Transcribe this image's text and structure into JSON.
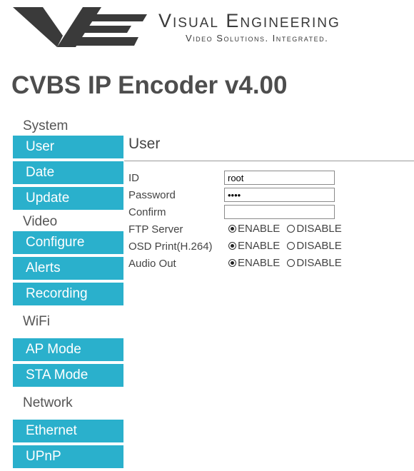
{
  "header": {
    "brand_title": "Visual Engineering",
    "brand_subtitle": "Video Solutions. Integrated.",
    "logo_icon": "visual-engineering-logo-icon"
  },
  "page_title": "CVBS IP Encoder v4.00",
  "nav": {
    "sections": [
      {
        "label": "System",
        "items": [
          "User",
          "Date",
          "Update"
        ]
      },
      {
        "label": "Video",
        "items": [
          "Configure",
          "Alerts",
          "Recording"
        ]
      },
      {
        "label": "WiFi",
        "items": [
          "AP Mode",
          "STA Mode"
        ]
      },
      {
        "label": "Network",
        "items": [
          "Ethernet",
          "UPnP"
        ]
      }
    ],
    "accent_color": "#2ab0cc"
  },
  "content": {
    "title": "User",
    "fields": {
      "id": {
        "label": "ID",
        "value": "root"
      },
      "password": {
        "label": "Password",
        "value": "••••"
      },
      "confirm": {
        "label": "Confirm",
        "value": ""
      }
    },
    "radios": [
      {
        "label": "FTP Server",
        "options": [
          "ENABLE",
          "DISABLE"
        ],
        "selected": "ENABLE"
      },
      {
        "label": "OSD Print(H.264)",
        "options": [
          "ENABLE",
          "DISABLE"
        ],
        "selected": "ENABLE"
      },
      {
        "label": "Audio Out",
        "options": [
          "ENABLE",
          "DISABLE"
        ],
        "selected": "ENABLE"
      }
    ]
  }
}
